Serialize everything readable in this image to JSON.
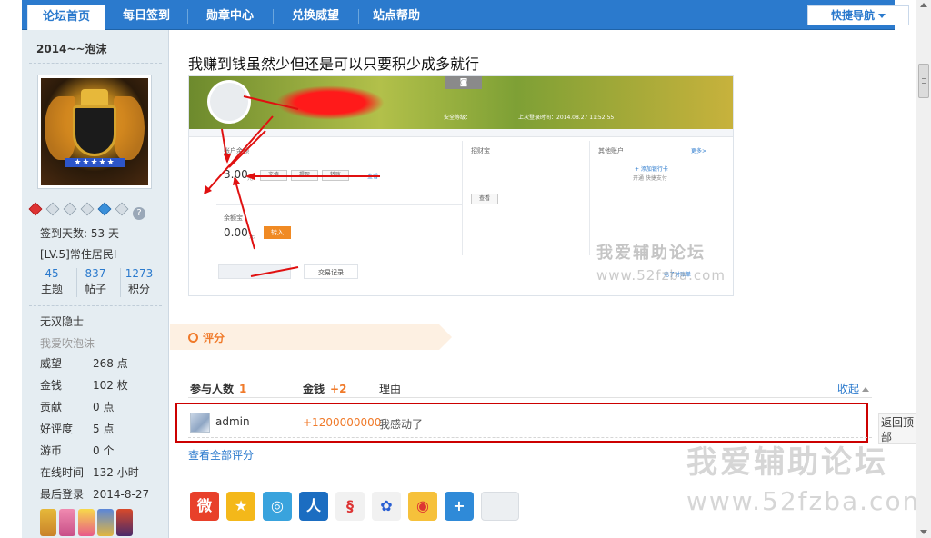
{
  "nav": {
    "tabs": [
      {
        "label": "论坛首页",
        "active": true
      },
      {
        "label": "每日签到"
      },
      {
        "label": "勋章中心"
      },
      {
        "label": "兑换威望"
      },
      {
        "label": "站点帮助"
      }
    ],
    "quick_nav": "快捷导航"
  },
  "profile": {
    "username": "2014~~泡沫",
    "signin_days": "签到天数: 53 天",
    "level": "[LV.5]常住居民I",
    "counts": [
      {
        "num": "45",
        "label": "主题"
      },
      {
        "num": "837",
        "label": "帖子"
      },
      {
        "num": "1273",
        "label": "积分"
      }
    ],
    "title": "无双隐士",
    "subtitle": "我爱吹泡沫",
    "stats": [
      {
        "k": "威望",
        "v": "268 点"
      },
      {
        "k": "金钱",
        "v": "102 枚"
      },
      {
        "k": "贡献",
        "v": "0 点"
      },
      {
        "k": "好评度",
        "v": "5 点"
      },
      {
        "k": "游币",
        "v": "0 个"
      },
      {
        "k": "在线时间",
        "v": "132 小时"
      },
      {
        "k": "最后登录",
        "v": "2014-8-27"
      }
    ]
  },
  "post": {
    "text": "我赚到钱虽然少但还是可以只要积少成多就行",
    "screenshot": {
      "balance_label": "账户余额",
      "balance_value": "3.00",
      "balance_unit": "元",
      "btn_recharge": "充值",
      "btn_withdraw": "提现",
      "btn_transfer": "转账",
      "link_view": "查看",
      "yuebao_label": "余额宝",
      "yuebao_value": "0.00",
      "yuebao_unit": "元",
      "btn_in": "转入",
      "zhaocaibao": "招财宝",
      "btn_view": "查看",
      "other_accounts": "其他账户",
      "more": "更多>",
      "add_card": "+ 添加银行卡",
      "kuaijie": "开通 快捷支付",
      "tab_trade": "交易记录",
      "bill": "电子对账单",
      "login_time": "上次登录时间：2014.08.27 11:52:55",
      "security": "安全等级：",
      "wm_cn": "我爱辅助论坛",
      "wm_url": "www.52fzba.com"
    }
  },
  "rating": {
    "banner": "评分",
    "col_participants": "参与人数",
    "participants_count": "1",
    "col_money": "金钱",
    "money_total": "+2",
    "col_reason": "理由",
    "collapse": "收起",
    "rows": [
      {
        "user": "admin",
        "value": "+1200000000",
        "reason": "我感动了"
      }
    ],
    "view_all": "查看全部评分"
  },
  "share_icons": [
    "weibo-icon",
    "qzone-icon",
    "tencent-weibo-icon",
    "renren-icon",
    "sohu-icon",
    "baidu-icon",
    "qq-icon",
    "more-share-icon"
  ],
  "watermark": {
    "cn": "我爱辅助论坛",
    "url": "www.52fzba.com"
  },
  "back_to_top": "返回顶部",
  "colors": {
    "nav_blue": "#2b7acd",
    "accent_orange": "#f07a2a",
    "highlight_red": "#cc0000"
  }
}
